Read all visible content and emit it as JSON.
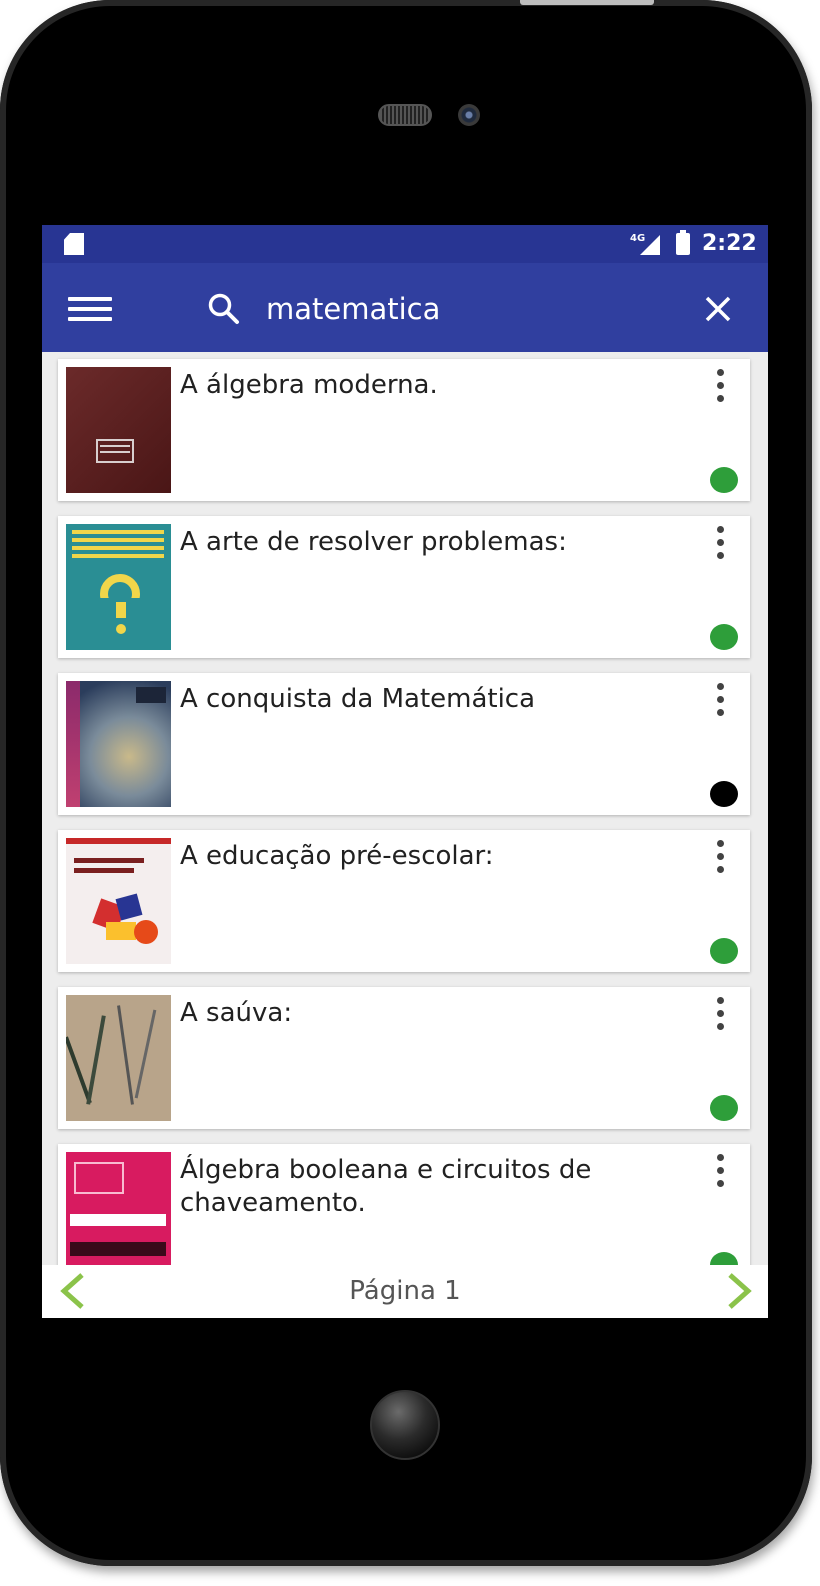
{
  "status_bar": {
    "network": "4G",
    "time": "2:22"
  },
  "toolbar": {
    "search_value": "matematica"
  },
  "results": [
    {
      "title": "A álgebra moderna.",
      "status": "available",
      "status_color": "#2e9e3a"
    },
    {
      "title": "A arte de resolver problemas:",
      "status": "available",
      "status_color": "#2e9e3a"
    },
    {
      "title": "A conquista da Matemática",
      "status": "unavailable",
      "status_color": "#000000"
    },
    {
      "title": "A educação pré-escolar:",
      "status": "available",
      "status_color": "#2e9e3a"
    },
    {
      "title": "A saúva:",
      "status": "available",
      "status_color": "#2e9e3a"
    },
    {
      "title": "Álgebra booleana e circuitos de chaveamento.",
      "status": "available",
      "status_color": "#2e9e3a"
    }
  ],
  "pagination": {
    "label": "Página 1"
  },
  "colors": {
    "status_bar": "#283593",
    "toolbar": "#303f9f",
    "accent_arrow": "#8bc34a",
    "available": "#2e9e3a",
    "unavailable": "#000000"
  },
  "icons": [
    "sd-card-icon",
    "signal-4g-icon",
    "battery-icon",
    "menu-icon",
    "search-icon",
    "close-icon",
    "more-vert-icon",
    "chevron-left-icon",
    "chevron-right-icon"
  ]
}
